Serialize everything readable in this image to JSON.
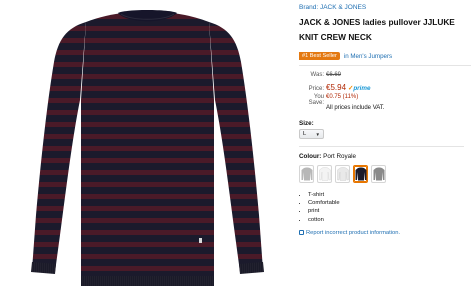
{
  "brand_line": "Brand: JACK & JONES",
  "product_title": "JACK & JONES ladies pullover JJLUKE KNIT CREW NECK",
  "badge": {
    "label": "#1 Best Seller",
    "category": "in Men's Jumpers"
  },
  "prices": {
    "was_label": "Was:",
    "was_value": "€6.69",
    "price_label": "Price:",
    "price_value": "€5.94",
    "prime_label": "prime",
    "save_label": "You Save:",
    "save_value": "€0.75 (11%)",
    "vat_note": "All prices include VAT."
  },
  "size": {
    "label": "Size:",
    "selected": "L"
  },
  "colour": {
    "label": "Colour:",
    "value": "Port Royale"
  },
  "swatches": [
    {
      "name": "light-grey",
      "color": "#b7b7b7"
    },
    {
      "name": "white",
      "color": "#f3f3f3"
    },
    {
      "name": "white-2",
      "color": "#e9e9e9"
    },
    {
      "name": "port-royale",
      "color": "#1d1b2a",
      "selected": true
    },
    {
      "name": "grey",
      "color": "#8a8a8a"
    }
  ],
  "features": [
    "T-shirt",
    "Comfortable",
    "print",
    "cotton"
  ],
  "report_link": "Report incorrect product information.",
  "colors": {
    "link": "#1f6fb2",
    "price": "#b12704",
    "badge": "#e47911",
    "sweater_navy": "#1b1a2c",
    "sweater_stripe": "#4a1a28"
  }
}
